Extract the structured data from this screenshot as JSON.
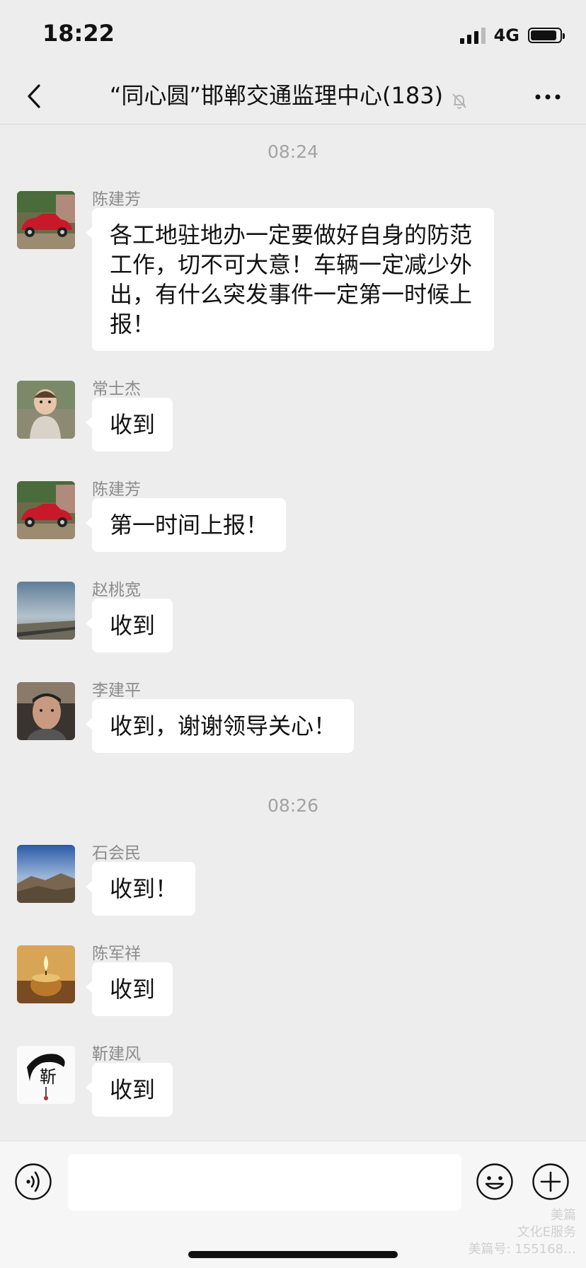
{
  "status_bar": {
    "time": "18:22",
    "network": "4G",
    "battery_level": 0.9
  },
  "nav": {
    "title": "“同心圆”邯郸交通监理中心(183)"
  },
  "messages": {
    "ts1": "08:24",
    "ts2": "08:26",
    "m1": {
      "sender": "陈建芳",
      "text": "各工地驻地办一定要做好自身的防范工作，切不可大意！车辆一定减少外出，有什么突发事件一定第一时候上报！"
    },
    "m2": {
      "sender": "常士杰",
      "text": "收到"
    },
    "m3": {
      "sender": "陈建芳",
      "text": "第一时间上报！"
    },
    "m4": {
      "sender": "赵桃宽",
      "text": "收到"
    },
    "m5": {
      "sender": "李建平",
      "text": "收到，谢谢领导关心！"
    },
    "m6": {
      "sender": "石会民",
      "text": "收到！"
    },
    "m7": {
      "sender": "陈军祥",
      "text": "收到"
    },
    "m8": {
      "sender": "靳建风",
      "text": "收到"
    }
  },
  "avatar_text": {
    "m8": "靳"
  },
  "watermark": {
    "line1": "美篇",
    "line2": "文化E服务",
    "line3": "美篇号: 155168…"
  }
}
